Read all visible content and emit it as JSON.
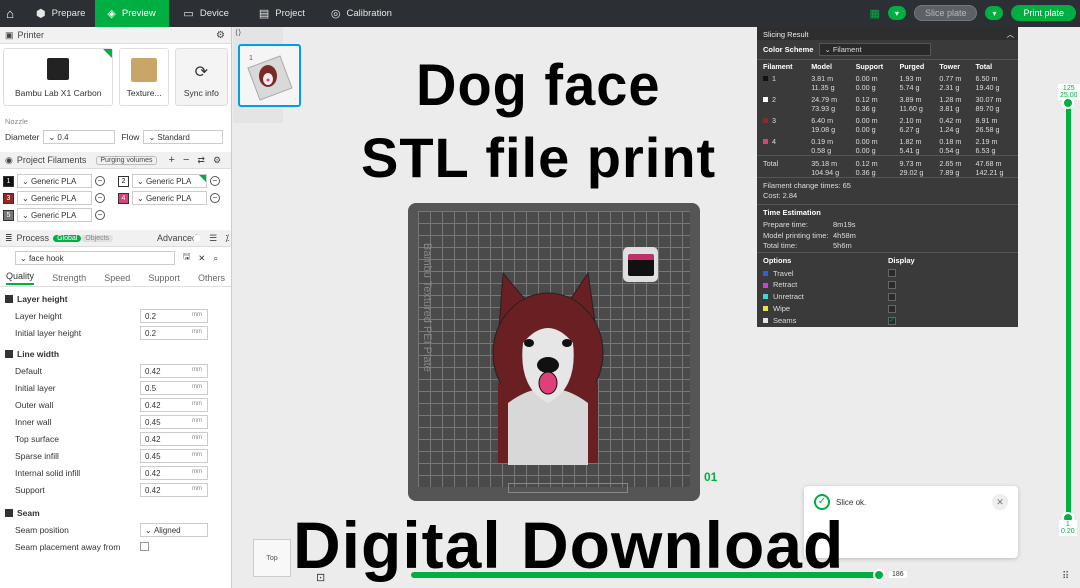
{
  "topbar": {
    "tabs": [
      {
        "label": "Prepare",
        "active": false
      },
      {
        "label": "Preview",
        "active": true
      },
      {
        "label": "Device",
        "active": false
      },
      {
        "label": "Project",
        "active": false
      },
      {
        "label": "Calibration",
        "active": false
      }
    ],
    "slice_label": "Slice plate",
    "print_label": "Print plate"
  },
  "printer": {
    "header": "Printer",
    "name": "Bambu Lab X1 Carbon",
    "plate": "Texture...",
    "sync": "Sync info",
    "nozzle_label": "Nozzle",
    "diameter_label": "Diameter",
    "diameter_value": "0.4",
    "flow_label": "Flow",
    "flow_value": "Standard"
  },
  "filaments": {
    "header": "Project Filaments",
    "purging": "Purging volumes",
    "items": [
      {
        "num": "1",
        "color": "#111111",
        "name": "Generic PLA"
      },
      {
        "num": "2",
        "color": "#ffffff",
        "name": "Generic PLA"
      },
      {
        "num": "3",
        "color": "#8b2a2a",
        "name": "Generic PLA"
      },
      {
        "num": "4",
        "color": "#e0407a",
        "name": "Generic PLA"
      },
      {
        "num": "5",
        "color": "#777777",
        "name": "Generic PLA"
      }
    ]
  },
  "process": {
    "header": "Process",
    "global": "Global",
    "objects": "Objects",
    "advanced": "Advanced",
    "preset": "face hook",
    "tabs": [
      "Quality",
      "Strength",
      "Speed",
      "Support",
      "Others"
    ],
    "layer_height_group": "Layer height",
    "layer_height": [
      {
        "label": "Layer height",
        "value": "0.2"
      },
      {
        "label": "Initial layer height",
        "value": "0.2"
      }
    ],
    "line_width_group": "Line width",
    "line_width": [
      {
        "label": "Default",
        "value": "0.42"
      },
      {
        "label": "Initial layer",
        "value": "0.5"
      },
      {
        "label": "Outer wall",
        "value": "0.42"
      },
      {
        "label": "Inner wall",
        "value": "0.45"
      },
      {
        "label": "Top surface",
        "value": "0.42"
      },
      {
        "label": "Sparse infill",
        "value": "0.45"
      },
      {
        "label": "Internal solid infill",
        "value": "0.42"
      },
      {
        "label": "Support",
        "value": "0.42"
      }
    ],
    "seam_group": "Seam",
    "seam_position_label": "Seam position",
    "seam_position_value": "Aligned",
    "seam_away_label": "Seam placement away from",
    "unit": "mm"
  },
  "overlay": {
    "title1": "Dog face",
    "title2": "STL file print",
    "title3": "Digital Download"
  },
  "viewport": {
    "plate_number": "01",
    "bed_label": "Bambu Textured PEI Plate",
    "view_cube": "Top",
    "slider_top": "125",
    "slider_top2": "25.00",
    "slider_bottom": "1",
    "slider_bottom2": "0.20",
    "hbar_value": "186",
    "toast": "Slice ok."
  },
  "slicing": {
    "title": "Slicing Result",
    "color_scheme_label": "Color Scheme",
    "color_scheme_value": "Filament",
    "columns": [
      "Filament",
      "Model",
      "Support",
      "Purged",
      "Tower",
      "Total"
    ],
    "rows": [
      {
        "id": "1",
        "color": "#111111",
        "model": [
          "3.81 m",
          "11.35 g"
        ],
        "support": [
          "0.00 m",
          "0.00 g"
        ],
        "purged": [
          "1.93 m",
          "5.74 g"
        ],
        "tower": [
          "0.77 m",
          "2.31 g"
        ],
        "total": [
          "6.50 m",
          "19.40 g"
        ]
      },
      {
        "id": "2",
        "color": "#ffffff",
        "model": [
          "24.79 m",
          "73.93 g"
        ],
        "support": [
          "0.12 m",
          "0.36 g"
        ],
        "purged": [
          "3.89 m",
          "11.60 g"
        ],
        "tower": [
          "1.28 m",
          "3.81 g"
        ],
        "total": [
          "30.07 m",
          "89.70 g"
        ]
      },
      {
        "id": "3",
        "color": "#8b2a2a",
        "model": [
          "6.40 m",
          "19.08 g"
        ],
        "support": [
          "0.00 m",
          "0.00 g"
        ],
        "purged": [
          "2.10 m",
          "6.27 g"
        ],
        "tower": [
          "0.42 m",
          "1.24 g"
        ],
        "total": [
          "8.91 m",
          "26.58 g"
        ]
      },
      {
        "id": "4",
        "color": "#e0407a",
        "model": [
          "0.19 m",
          "0.58 g"
        ],
        "support": [
          "0.00 m",
          "0.00 g"
        ],
        "purged": [
          "1.82 m",
          "5.41 g"
        ],
        "tower": [
          "0.18 m",
          "0.54 g"
        ],
        "total": [
          "2.19 m",
          "6.53 g"
        ]
      }
    ],
    "total_row": {
      "label": "Total",
      "model": [
        "35.18 m",
        "104.94 g"
      ],
      "support": [
        "0.12 m",
        "0.36 g"
      ],
      "purged": [
        "9.73 m",
        "29.02 g"
      ],
      "tower": [
        "2.65 m",
        "7.89 g"
      ],
      "total": [
        "47.68 m",
        "142.21 g"
      ]
    },
    "filament_changes": "Filament change times:  65",
    "cost": "Cost:  2.84",
    "time_title": "Time Estimation",
    "prepare_label": "Prepare time:",
    "prepare_value": "8m19s",
    "model_label": "Model printing time:",
    "model_value": "4h58m",
    "total_label": "Total time:",
    "total_value": "5h6m",
    "options_label": "Options",
    "display_label": "Display",
    "options": [
      {
        "label": "Travel",
        "color": "#3a5bd9",
        "checked": false
      },
      {
        "label": "Retract",
        "color": "#d63ad9",
        "checked": false
      },
      {
        "label": "Unretract",
        "color": "#3ad9d9",
        "checked": false
      },
      {
        "label": "Wipe",
        "color": "#e6e63a",
        "checked": false
      },
      {
        "label": "Seams",
        "color": "#e6e6e6",
        "checked": true
      }
    ]
  }
}
